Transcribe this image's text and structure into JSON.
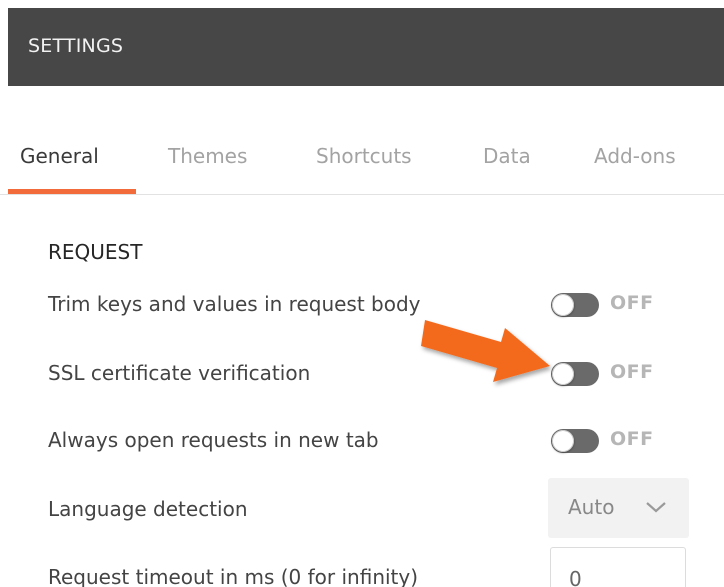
{
  "header": {
    "title": "SETTINGS"
  },
  "tabs": [
    {
      "label": "General",
      "active": true
    },
    {
      "label": "Themes",
      "active": false
    },
    {
      "label": "Shortcuts",
      "active": false
    },
    {
      "label": "Data",
      "active": false
    },
    {
      "label": "Add-ons",
      "active": false
    }
  ],
  "section": {
    "title": "REQUEST"
  },
  "settings": {
    "trim": {
      "label": "Trim keys and values in request body",
      "state": "OFF"
    },
    "ssl": {
      "label": "SSL certificate verification",
      "state": "OFF"
    },
    "new_tab": {
      "label": "Always open requests in new tab",
      "state": "OFF"
    },
    "language": {
      "label": "Language detection",
      "value": "Auto"
    },
    "timeout": {
      "label": "Request timeout in ms (0 for infinity)",
      "value": "0"
    }
  },
  "colors": {
    "header_bg": "#474747",
    "accent": "#f26b3a",
    "arrow": "#f46a1f",
    "toggle_off": "#6a6a6a"
  },
  "icons": {
    "dropdown": "chevron-down-icon",
    "annotation": "arrow-annotation-icon"
  }
}
